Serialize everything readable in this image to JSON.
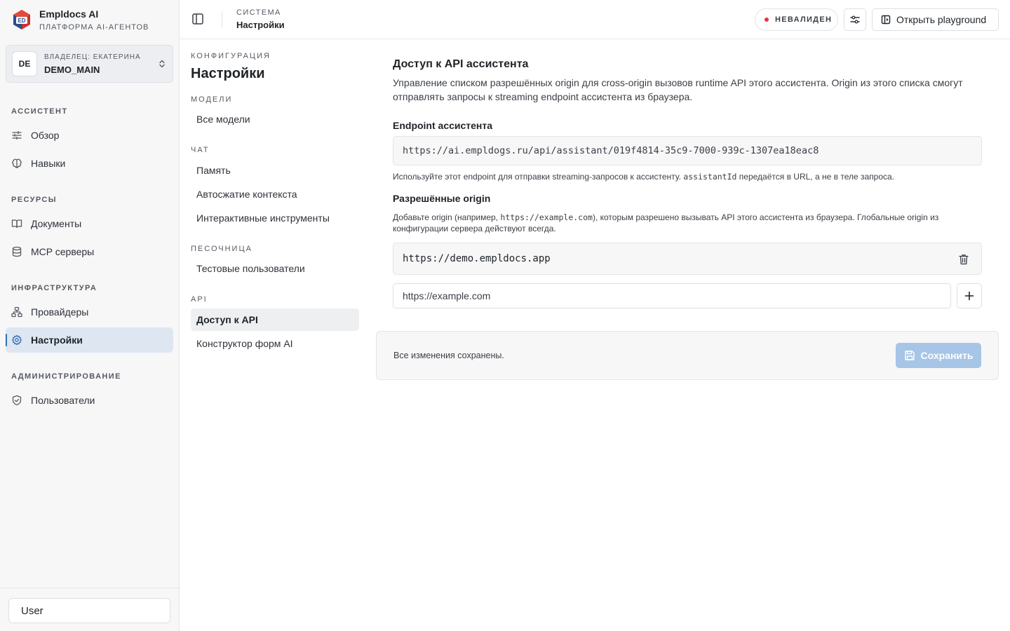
{
  "brand": {
    "name": "Empldocs AI",
    "subtitle": "ПЛАТФОРМА AI-АГЕНТОВ",
    "logo_text": "ED"
  },
  "owner": {
    "initials": "DE",
    "label": "ВЛАДЕЛЕЦ: ЕКАТЕРИНА",
    "workspace": "DEMO_MAIN"
  },
  "sidebar": {
    "sections": [
      {
        "title": "АССИСТЕНТ"
      },
      {
        "title": "РЕСУРСЫ"
      },
      {
        "title": "ИНФРАСТРУКТУРА"
      },
      {
        "title": "АДМИНИСТРИРОВАНИЕ"
      }
    ],
    "items": [
      {
        "label": "Обзор",
        "icon": "sliders-icon"
      },
      {
        "label": "Навыки",
        "icon": "brain-icon"
      },
      {
        "label": "Документы",
        "icon": "book-icon"
      },
      {
        "label": "MCP серверы",
        "icon": "database-icon"
      },
      {
        "label": "Провайдеры",
        "icon": "network-icon"
      },
      {
        "label": "Настройки",
        "icon": "gear-icon",
        "active": true
      },
      {
        "label": "Пользователи",
        "icon": "shield-icon"
      }
    ],
    "user": "User"
  },
  "header": {
    "breadcrumb_parent": "СИСТЕМА",
    "breadcrumb_current": "Настройки",
    "status": "НЕВАЛИДЕН",
    "status_color": "#e0344b",
    "playground_label": "Открыть playground"
  },
  "settings_nav": {
    "eyebrow": "КОНФИГУРАЦИЯ",
    "title": "Настройки",
    "sections": [
      {
        "title": "МОДЕЛИ",
        "items": [
          "Все модели"
        ]
      },
      {
        "title": "ЧАТ",
        "items": [
          "Память",
          "Автосжатие контекста",
          "Интерактивные инструменты"
        ]
      },
      {
        "title": "ПЕСОЧНИЦА",
        "items": [
          "Тестовые пользователи"
        ]
      },
      {
        "title": "API",
        "items": [
          "Доступ к API",
          "Конструктор форм AI"
        ]
      }
    ],
    "active_item": "Доступ к API"
  },
  "main": {
    "title": "Доступ к API ассистента",
    "description": "Управление списком разрешённых origin для cross-origin вызовов runtime API этого ассистента. Origin из этого списка смогут отправлять запросы к streaming endpoint ассистента из браузера.",
    "endpoint_label": "Endpoint ассистента",
    "endpoint_value": "https://ai.empldogs.ru/api/assistant/019f4814-35c9-7000-939c-1307ea18eac8",
    "endpoint_hint_before": "Используйте этот endpoint для отправки streaming-запросов к ассистенту.",
    "endpoint_hint_code": "assistantId",
    "endpoint_hint_after": "передаётся в URL, а не в теле запроса.",
    "origins_label": "Разрешённые origin",
    "origins_hint_before": "Добавьте origin (например,",
    "origins_hint_code": "https://example.com",
    "origins_hint_after": "), которым разрешено вызывать API этого ассистента из браузера. Глобальные origin из конфигурации сервера действуют всегда.",
    "origins": [
      "https://demo.empldocs.app"
    ],
    "new_origin_placeholder": "https://example.com",
    "new_origin_value": ""
  },
  "save_bar": {
    "status": "Все изменения сохранены.",
    "save_label": "Сохранить",
    "save_color": "#a7c5e6"
  },
  "colors": {
    "accent": "#2f6fb3",
    "active_nav_bg": "#dde6f1",
    "sidebar_bg": "#f7f7f8"
  }
}
